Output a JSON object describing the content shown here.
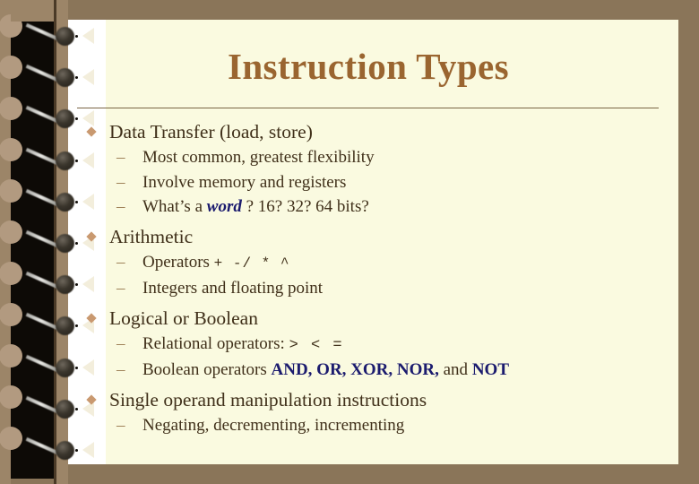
{
  "slide": {
    "title": "Instruction Types",
    "theme": {
      "background": "#8a7559",
      "page": "#fafae0",
      "title_color": "#9a6530",
      "body_color": "#40301a",
      "accent_keyword": "#1b1b6e",
      "bullet_diamond": "#c99970",
      "rule_color": "#7b6545"
    },
    "bullets": [
      {
        "label": "Data Transfer (load, store)",
        "sub": [
          {
            "text": "Most common, greatest flexibility"
          },
          {
            "text": "Involve memory and registers"
          },
          {
            "prefix": "What’s a ",
            "keyword": "word",
            "suffix": " ?  16? 32? 64 bits?"
          }
        ]
      },
      {
        "label": "Arithmetic",
        "sub": [
          {
            "prefix": "Operators ",
            "operators": "+ -/ * ^"
          },
          {
            "text": "Integers and floating point"
          }
        ]
      },
      {
        "label": "Logical or Boolean",
        "sub": [
          {
            "prefix": "Relational operators: ",
            "operators": "> < ="
          },
          {
            "prefix": "Boolean operators ",
            "bool_ops_1": "AND, OR, XOR, NOR,",
            "conjunction": " and ",
            "bool_ops_2": "NOT"
          }
        ]
      },
      {
        "label": "Single operand manipulation instructions",
        "sub": [
          {
            "text": "Negating, decrementing, incrementing"
          }
        ]
      }
    ]
  }
}
